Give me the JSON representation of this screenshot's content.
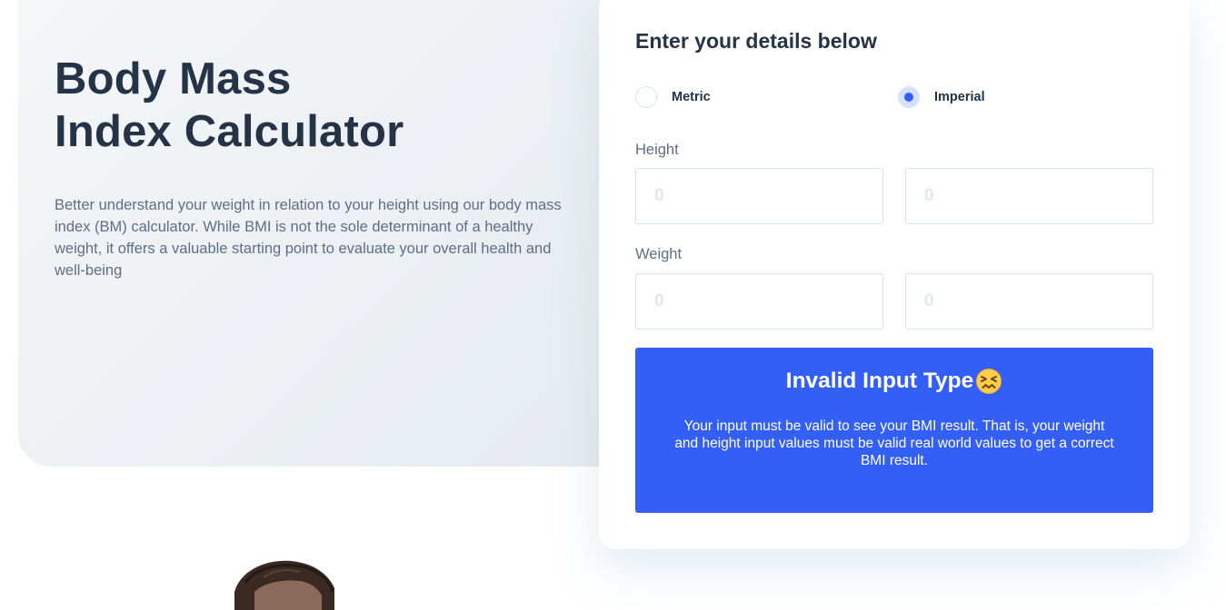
{
  "hero": {
    "title_line1": "Body Mass",
    "title_line2": "Index Calculator",
    "description": "Better understand your weight in relation to your height using our body mass index (BM) calculator. While BMI is not the sole determinant of a healthy weight, it offers a valuable starting point to evaluate your overall health and well-being"
  },
  "form": {
    "title": "Enter your details below",
    "units": {
      "options": [
        {
          "label": "Metric",
          "checked": false
        },
        {
          "label": "Imperial",
          "checked": true
        }
      ]
    },
    "height": {
      "label": "Height",
      "primary": {
        "value": "",
        "placeholder": "0"
      },
      "secondary": {
        "value": "",
        "placeholder": "0"
      }
    },
    "weight": {
      "label": "Weight",
      "primary": {
        "value": "",
        "placeholder": "0"
      },
      "secondary": {
        "value": "",
        "placeholder": "0"
      }
    }
  },
  "result": {
    "title": "Invalid Input Type",
    "icon": "confounded-face-emoji-icon",
    "message": "Your input must be valid to see your BMI result. That is, your weight and height input values must be valid real world values to get a correct BMI result."
  },
  "colors": {
    "primary": "#345ff6",
    "heading": "#253347",
    "body_text": "#5e6e85",
    "border": "#d8e2e7",
    "emoji_face": "#ffcc4d"
  }
}
